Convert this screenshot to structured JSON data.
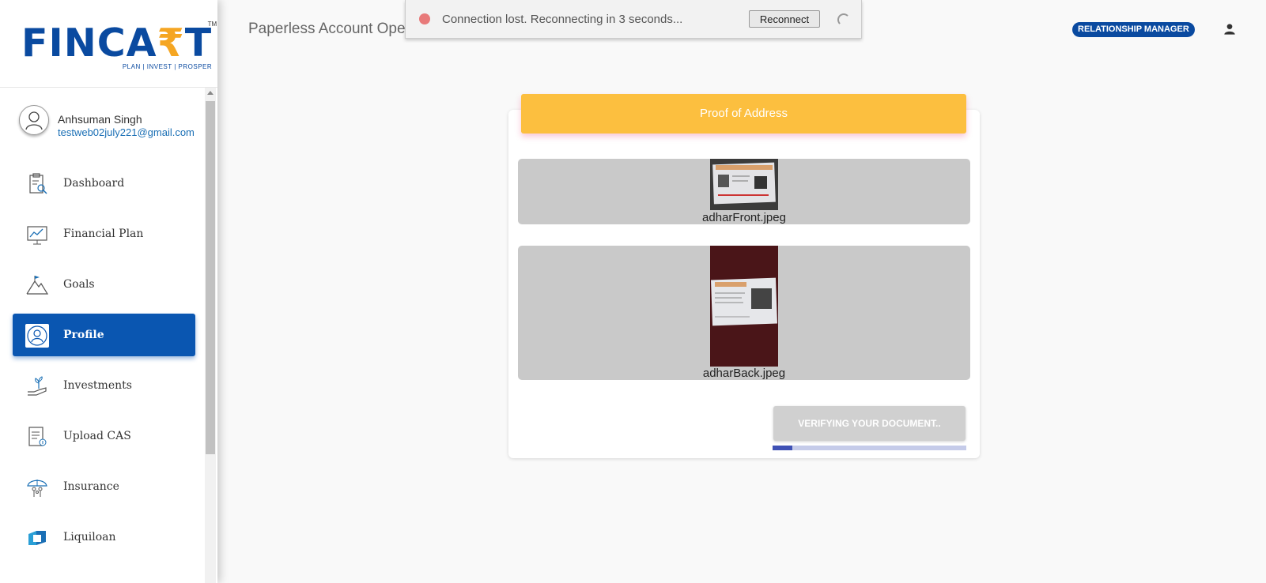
{
  "brand": {
    "name_left": "FINCA",
    "name_rupee": "₹",
    "name_right": "T",
    "tm": "TM",
    "tagline": "PLAN | INVEST | PROSPER"
  },
  "user": {
    "name": "Anhsuman Singh",
    "email": "testweb02july221@gmail.com"
  },
  "sidebar": {
    "items": [
      {
        "label": "Dashboard",
        "icon": "dashboard-icon",
        "active": false
      },
      {
        "label": "Financial Plan",
        "icon": "chart-line-icon",
        "active": false
      },
      {
        "label": "Goals",
        "icon": "mountain-flag-icon",
        "active": false
      },
      {
        "label": "Profile",
        "icon": "profile-icon",
        "active": true
      },
      {
        "label": "Investments",
        "icon": "plant-hand-icon",
        "active": false
      },
      {
        "label": "Upload CAS",
        "icon": "document-upload-icon",
        "active": false
      },
      {
        "label": "Insurance",
        "icon": "umbrella-family-icon",
        "active": false
      },
      {
        "label": "Liquiloan",
        "icon": "liquiloan-logo-icon",
        "active": false
      }
    ]
  },
  "header": {
    "title": "Paperless Account Ope",
    "role_badge": "RELATIONSHIP  MANAGER",
    "user_icon": "person-icon"
  },
  "toast": {
    "message": "Connection lost. Reconnecting in 3 seconds...",
    "button": "Reconnect",
    "status_color": "#e87a7a"
  },
  "card": {
    "title": "Proof of Address",
    "documents": [
      {
        "filename": "adharFront.jpeg"
      },
      {
        "filename": "adharBack.jpeg"
      }
    ],
    "verify_button": "VERIFYING YOUR DOCUMENT..",
    "progress_percent": 10
  },
  "colors": {
    "brand_blue": "#0a4aa0",
    "active_nav": "#0a56b1",
    "header_yellow": "#fcbf3f",
    "progress": "#3f51b5"
  }
}
